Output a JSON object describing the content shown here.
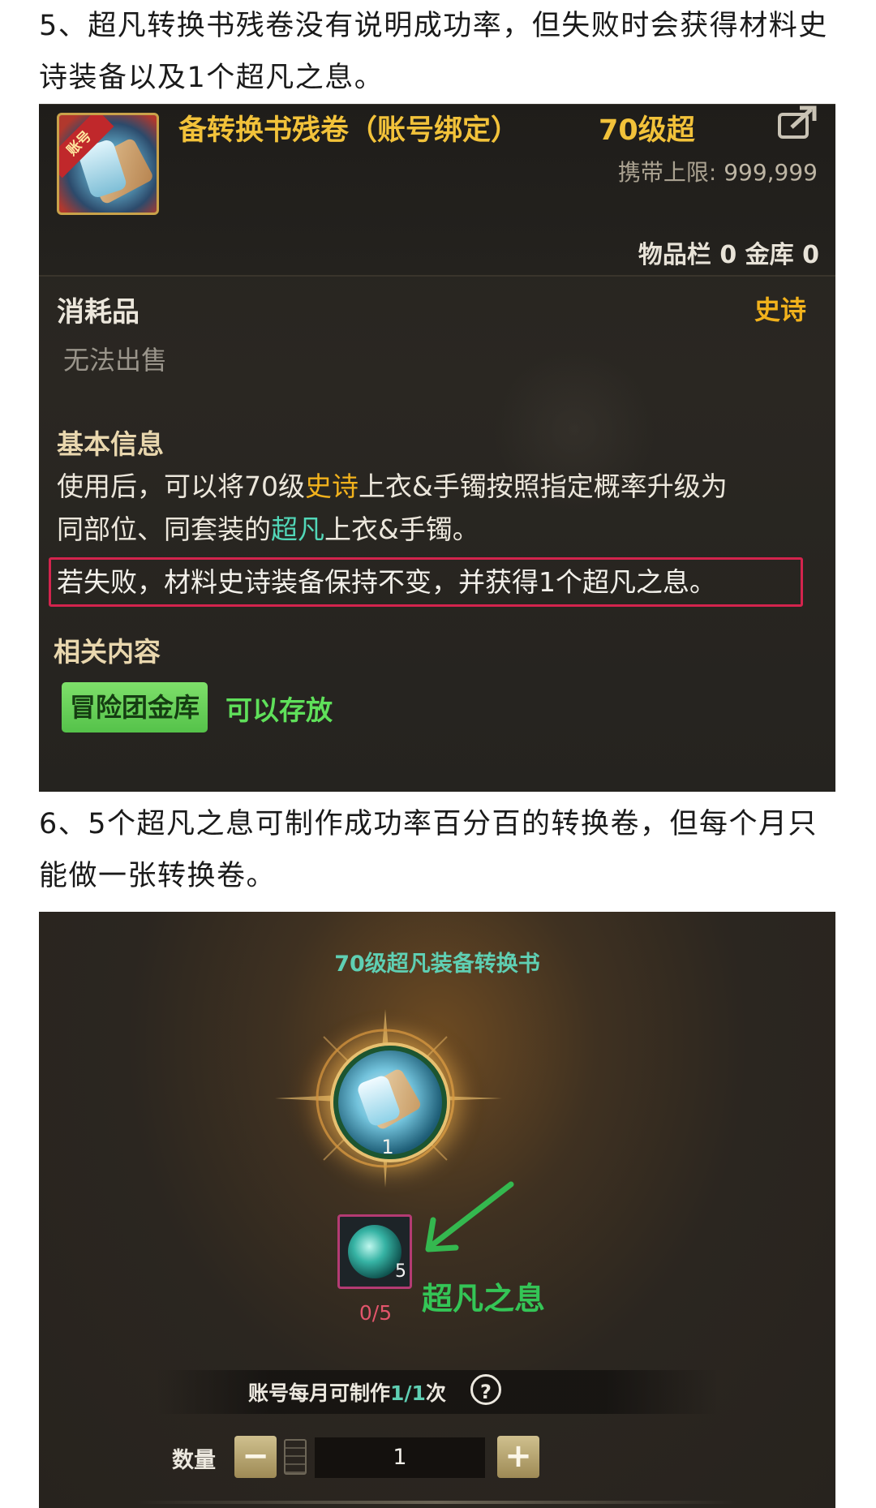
{
  "article": {
    "para5": "5、超凡转换书残卷没有说明成功率，但失败时会获得材料史诗装备以及1个超凡之息。",
    "para6": "6、5个超凡之息可制作成功率百分百的转换卷，但每个月只能做一张转换卷。"
  },
  "tooltip": {
    "badge_text": "账号",
    "item_name": "备转换书残卷（账号绑定）",
    "item_level": "70级超",
    "carry_limit_label": "携带上限:",
    "carry_limit_value": "999,999",
    "inventory_label": "物品栏",
    "inventory_count": "0",
    "vault_label": "金库",
    "vault_count": "0",
    "category": "消耗品",
    "rarity": "史诗",
    "rarity_color": "#f2b21c",
    "sell_status": "无法出售",
    "basic_info_title": "基本信息",
    "desc_line1_a": "使用后，可以将70级",
    "desc_line1_epic": "史诗",
    "desc_line1_b": "上衣&手镯按照指定概率升级为",
    "desc_line2_a": "同部位、同套装的",
    "desc_line2_legend": "超凡",
    "desc_line2_b": "上衣&手镯。",
    "desc_fail": "若失败，材料史诗装备保持不变，并获得1个超凡之息。",
    "related_title": "相关内容",
    "vault_badge": "冒险团金库",
    "vault_status": "可以存放",
    "share_icon": "share-icon"
  },
  "craft": {
    "title": "70级超凡装备转换书",
    "scroll_count": "1",
    "breath_qty": "5",
    "breath_progress": "0/5",
    "breath_label": "超凡之息",
    "monthly_prefix": "账号每月可制作",
    "monthly_count": "1/1",
    "monthly_suffix": "次",
    "help_icon": "?",
    "qty_label": "数量",
    "qty_minus": "−",
    "qty_plus": "+",
    "qty_value": "1"
  }
}
